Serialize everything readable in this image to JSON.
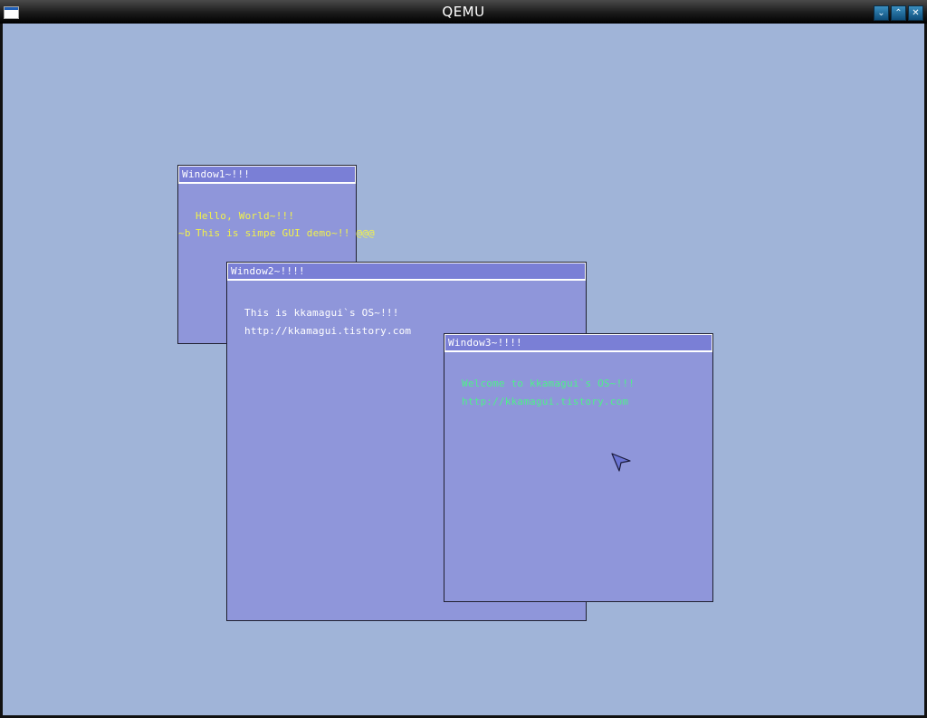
{
  "host": {
    "title": "QEMU",
    "buttons": {
      "minimize": "⌄",
      "maximize": "⌃",
      "close": "✕"
    }
  },
  "windows": {
    "w1": {
      "title": "Window1~!!!",
      "line1": "Hello, World~!!!",
      "line2_prefix": "~b",
      "line2": "This is simpe GUI demo~!! @@@",
      "text_color": "#f2f24a"
    },
    "w2": {
      "title": "Window2~!!!!",
      "line1": "This is kkamagui`s OS~!!!",
      "line2": "http://kkamagui.tistory.com",
      "text_color": "#ffffff"
    },
    "w3": {
      "title": "Window3~!!!!",
      "line1": "Welcome to kkamagui`s OS~!!!",
      "line2": "http://kkamagui.tistory.com",
      "text_color": "#4ef08a"
    }
  },
  "colors": {
    "desktop": "#a0b4d8",
    "window_body": "#8f96da",
    "window_title": "#7a7fd6"
  }
}
